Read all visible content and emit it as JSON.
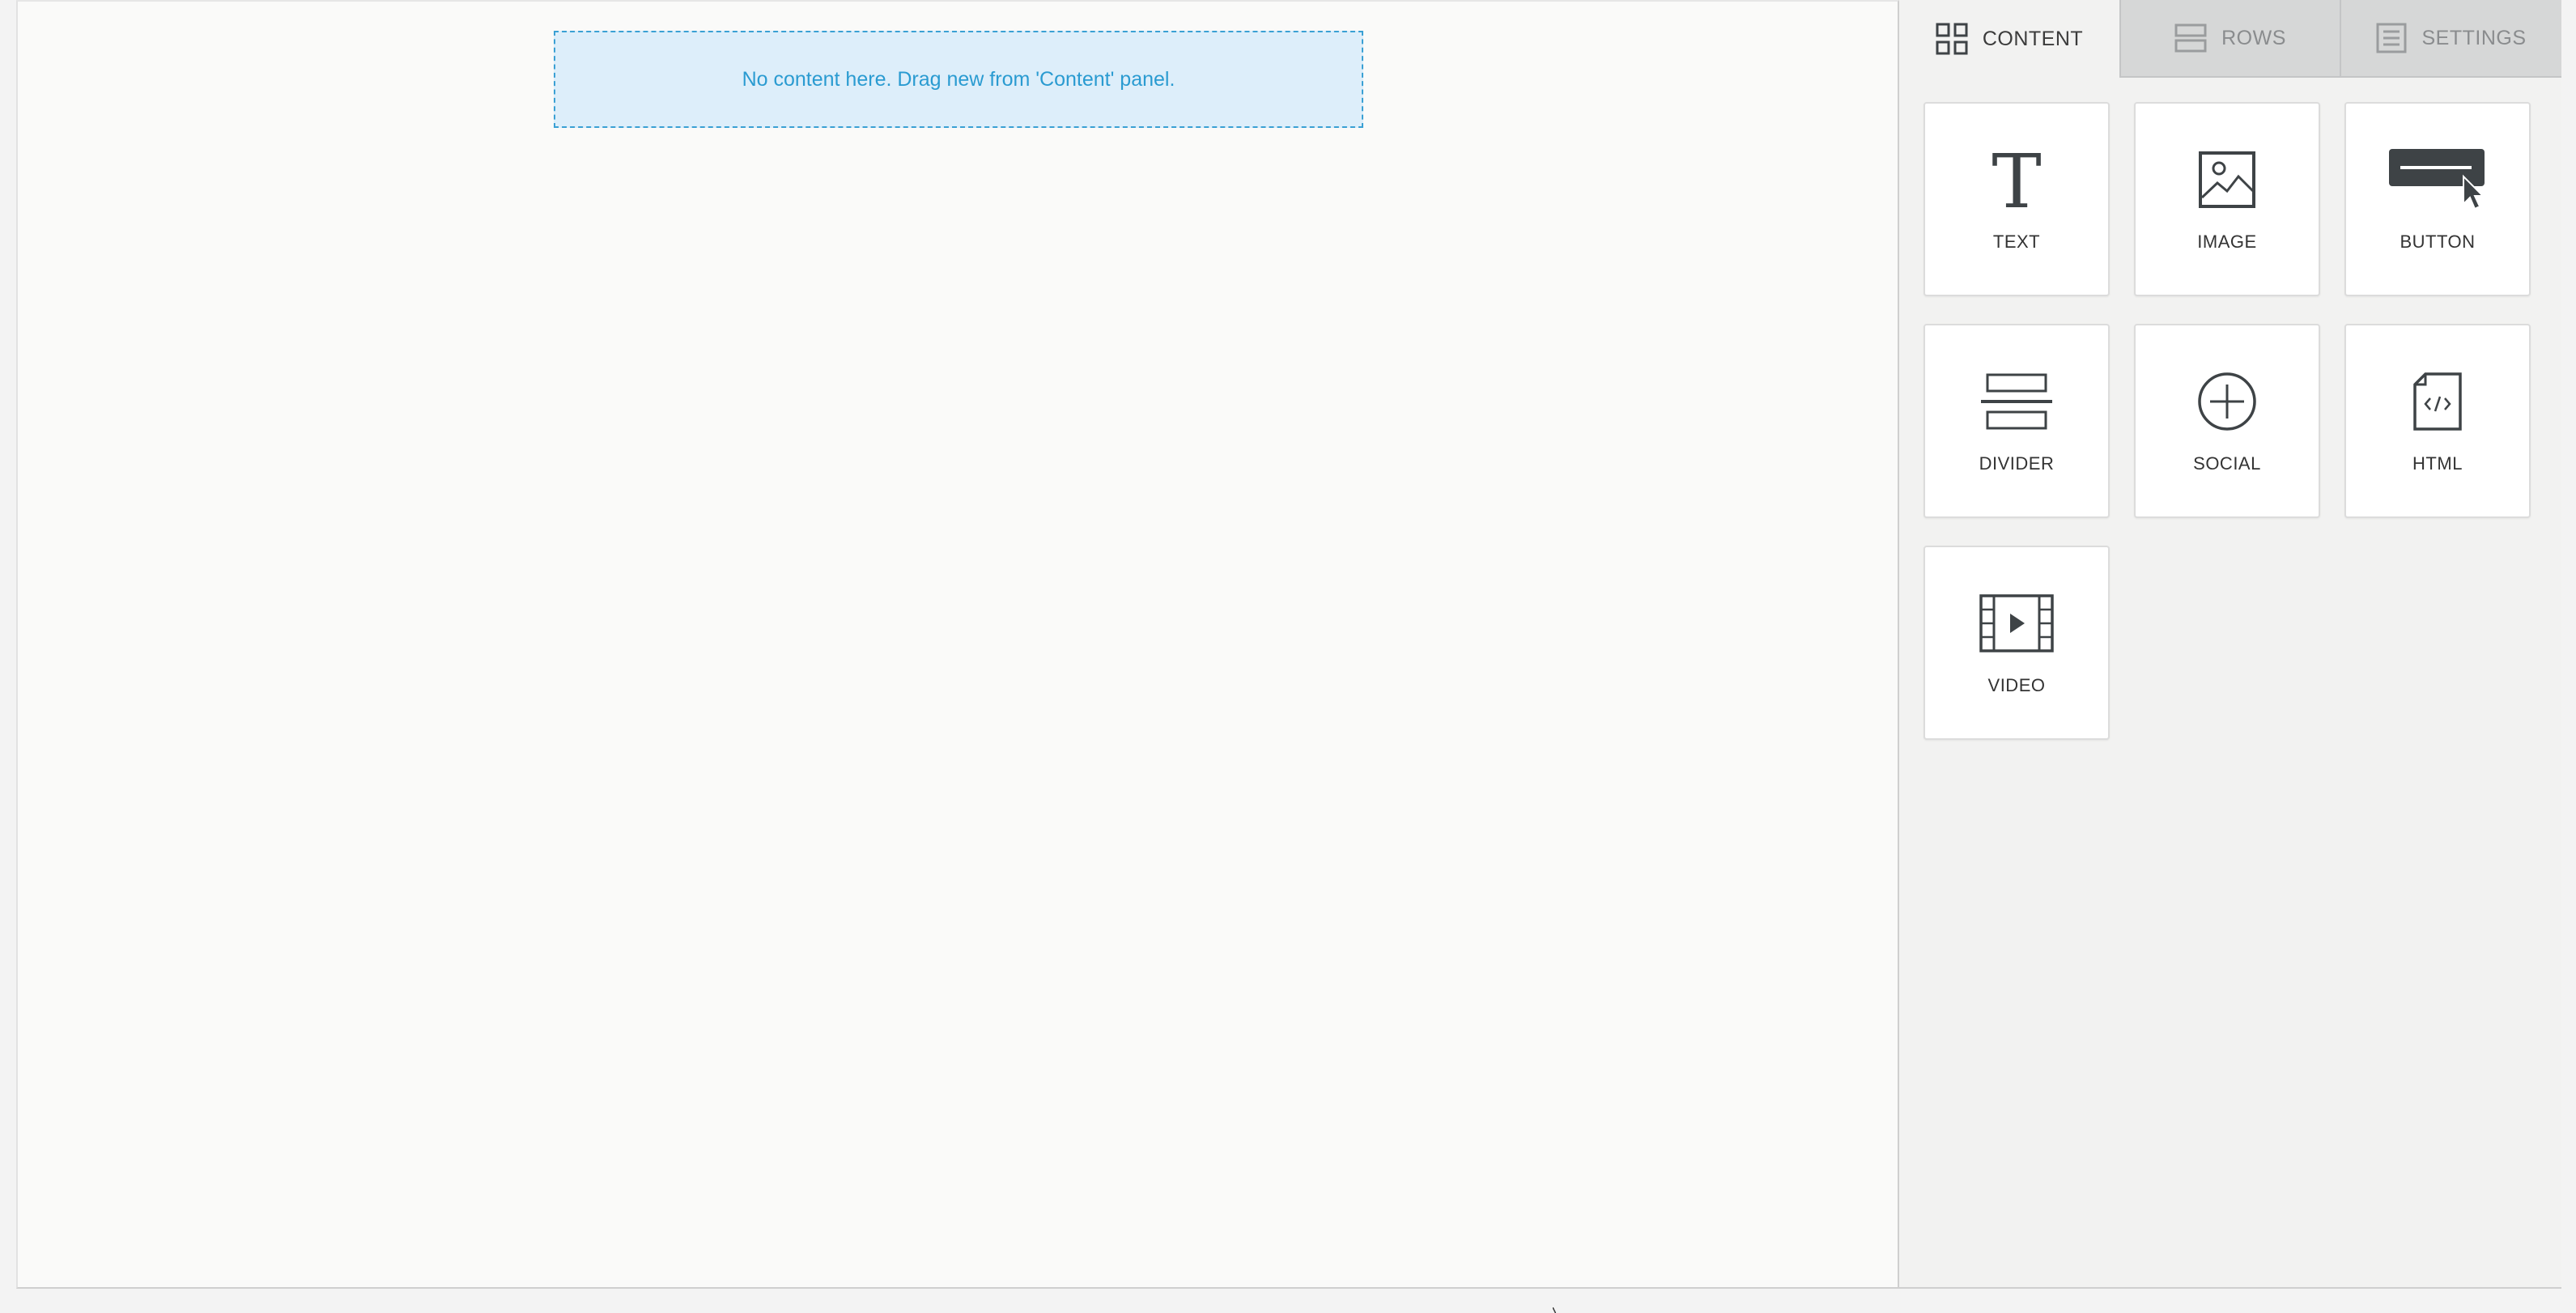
{
  "drop_zone": {
    "message": "No content here. Drag new from 'Content' panel."
  },
  "tabs": [
    {
      "label": "CONTENT",
      "icon": "grid-icon",
      "active": true
    },
    {
      "label": "ROWS",
      "icon": "rows-icon",
      "active": false
    },
    {
      "label": "SETTINGS",
      "icon": "settings-icon",
      "active": false
    }
  ],
  "blocks": [
    {
      "label": "TEXT",
      "icon": "text-icon"
    },
    {
      "label": "IMAGE",
      "icon": "image-icon"
    },
    {
      "label": "BUTTON",
      "icon": "button-icon"
    },
    {
      "label": "DIVIDER",
      "icon": "divider-icon"
    },
    {
      "label": "SOCIAL",
      "icon": "social-icon"
    },
    {
      "label": "HTML",
      "icon": "html-icon"
    },
    {
      "label": "VIDEO",
      "icon": "video-icon"
    }
  ],
  "colors": {
    "accent": "#2a9bd1",
    "drop_zone_bg": "#ddeefa",
    "icon": "#3e4346"
  }
}
